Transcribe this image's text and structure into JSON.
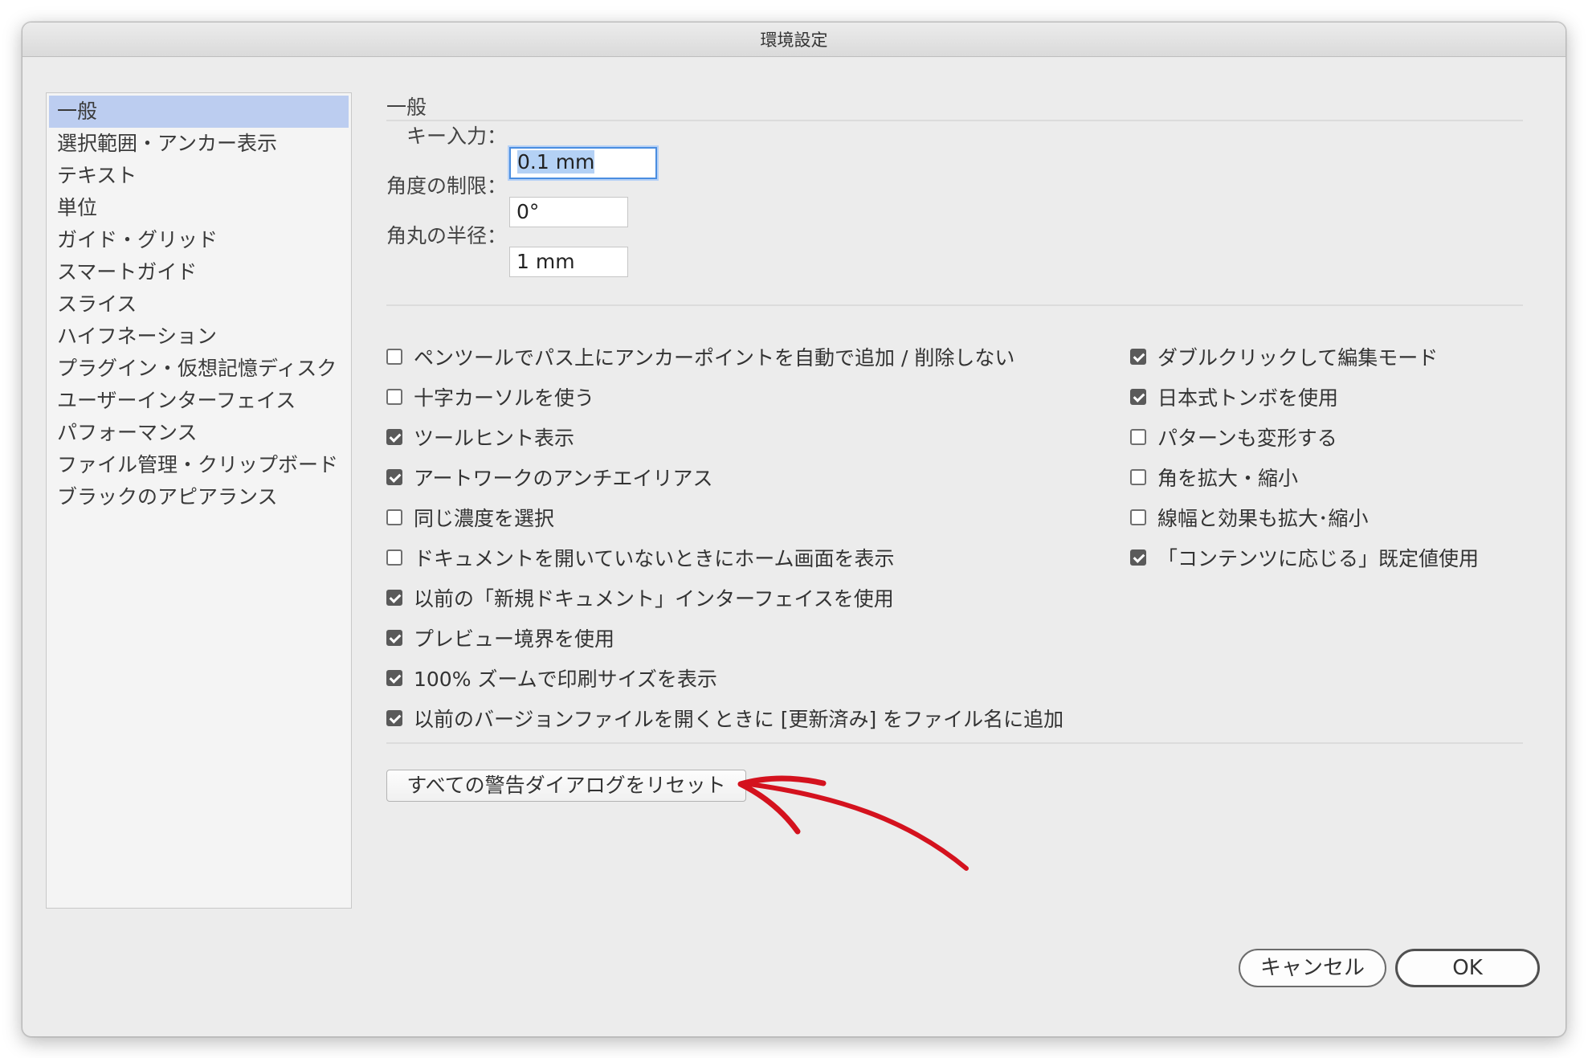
{
  "window": {
    "title": "環境設定"
  },
  "sidebar": {
    "items": [
      "一般",
      "選択範囲・アンカー表示",
      "テキスト",
      "単位",
      "ガイド・グリッド",
      "スマートガイド",
      "スライス",
      "ハイフネーション",
      "プラグイン・仮想記憶ディスク",
      "ユーザーインターフェイス",
      "パフォーマンス",
      "ファイル管理・クリップボード",
      "ブラックのアピアランス"
    ],
    "selected_index": 0
  },
  "main": {
    "section_title": "一般",
    "fields": {
      "key_input": {
        "label": "キー入力：",
        "value": "0.1 mm"
      },
      "angle_limit": {
        "label": "角度の制限：",
        "value": "0°"
      },
      "corner_radius": {
        "label": "角丸の半径：",
        "value": "1 mm"
      }
    },
    "checkboxes_left": [
      {
        "label": "ペンツールでパス上にアンカーポイントを自動で追加 / 削除しない",
        "checked": false
      },
      {
        "label": "十字カーソルを使う",
        "checked": false
      },
      {
        "label": "ツールヒント表示",
        "checked": true
      },
      {
        "label": "アートワークのアンチエイリアス",
        "checked": true
      },
      {
        "label": "同じ濃度を選択",
        "checked": false
      },
      {
        "label": "ドキュメントを開いていないときにホーム画面を表示",
        "checked": false
      },
      {
        "label": "以前の「新規ドキュメント」インターフェイスを使用",
        "checked": true
      },
      {
        "label": "プレビュー境界を使用",
        "checked": true
      },
      {
        "label": "100% ズームで印刷サイズを表示",
        "checked": true
      },
      {
        "label": "以前のバージョンファイルを開くときに [更新済み] をファイル名に追加",
        "checked": true
      }
    ],
    "checkboxes_right": [
      {
        "label": "ダブルクリックして編集モード",
        "checked": true
      },
      {
        "label": "日本式トンボを使用",
        "checked": true
      },
      {
        "label": "パターンも変形する",
        "checked": false
      },
      {
        "label": "角を拡大・縮小",
        "checked": false
      },
      {
        "label": "線幅と効果も拡大･縮小",
        "checked": false
      },
      {
        "label": "「コンテンツに応じる」既定値使用",
        "checked": true
      }
    ],
    "reset_button": "すべての警告ダイアログをリセット"
  },
  "buttons": {
    "cancel": "キャンセル",
    "ok": "OK"
  },
  "colors": {
    "selection": "#bccdf0",
    "annotation_arrow": "#d4121e",
    "focus_ring": "#4a8de0"
  }
}
